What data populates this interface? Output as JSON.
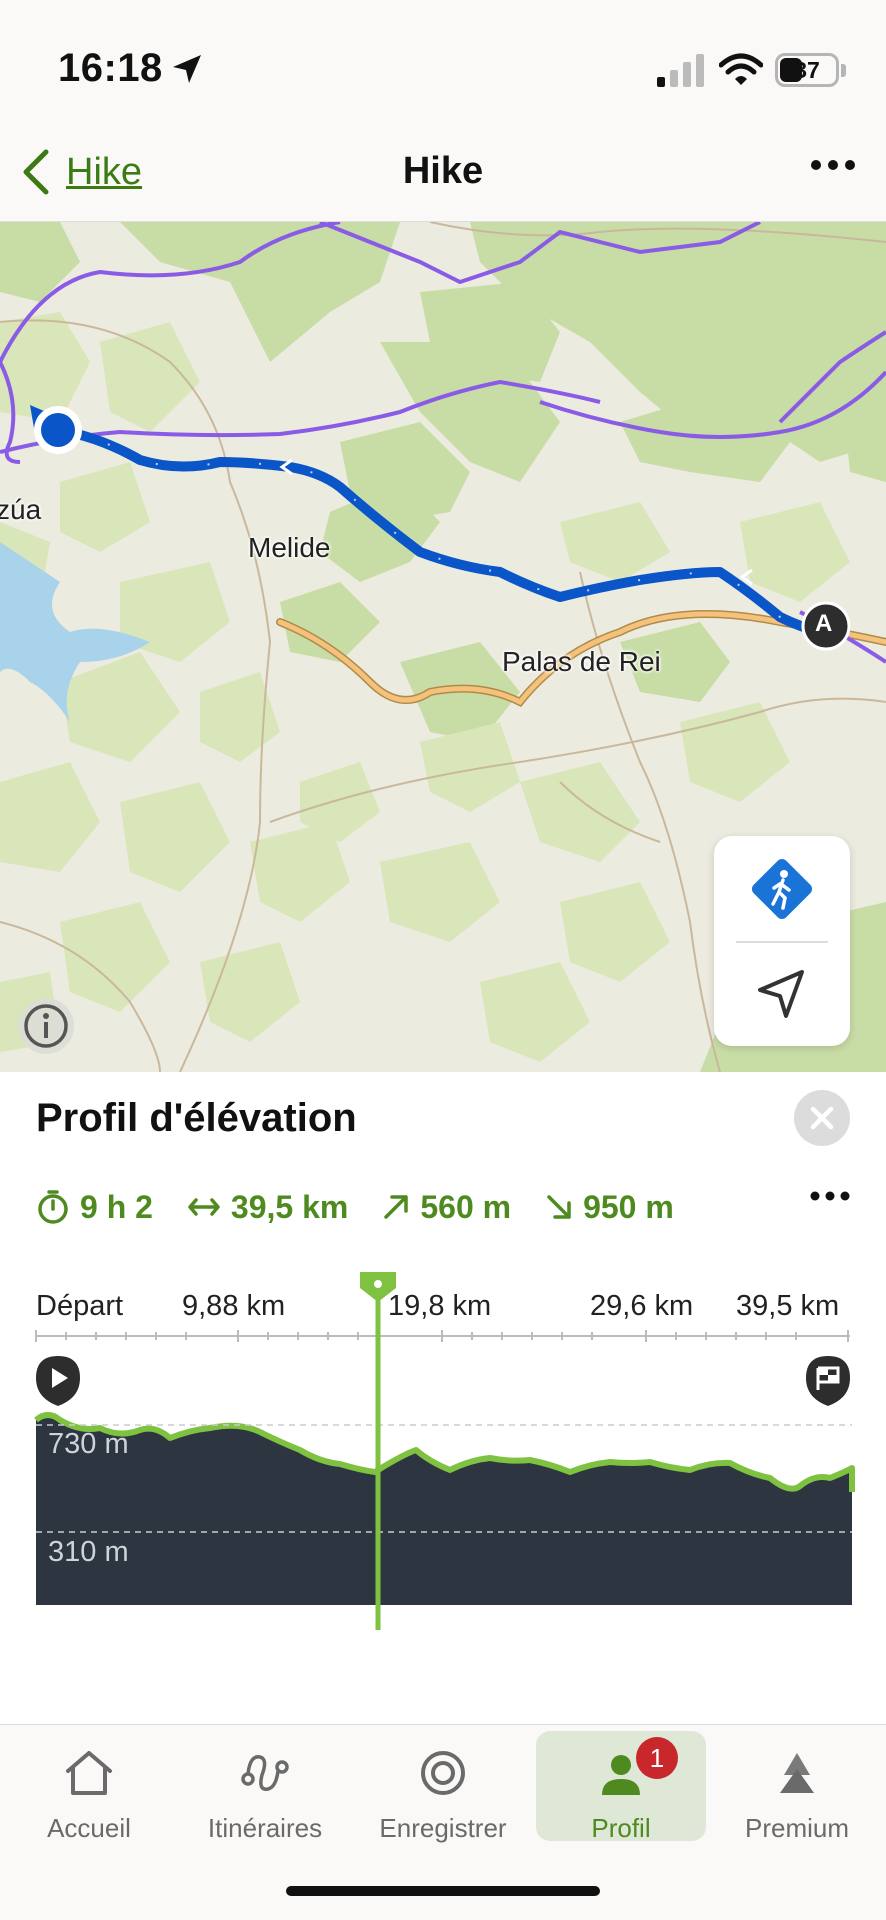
{
  "status": {
    "time": "16:18",
    "battery": "37"
  },
  "nav": {
    "back_label": "Hike",
    "title": "Hike"
  },
  "map": {
    "place_labels": [
      "Melide",
      "Palas de Rei",
      "zúa"
    ],
    "start_marker": "A"
  },
  "elevation": {
    "title": "Profil d'élévation",
    "stats": {
      "duration": "9 h 2",
      "distance": "39,5 km",
      "ascent": "560 m",
      "descent": "950 m"
    },
    "axis": [
      "Départ",
      "9,88 km",
      "19,8 km",
      "29,6 km",
      "39,5 km"
    ],
    "y_labels": [
      "730 m",
      "310 m"
    ]
  },
  "tabs": [
    {
      "label": "Accueil"
    },
    {
      "label": "Itinéraires"
    },
    {
      "label": "Enregistrer"
    },
    {
      "label": "Profil",
      "badge": "1"
    },
    {
      "label": "Premium"
    }
  ],
  "colors": {
    "accent": "#4e8a1f",
    "route": "#0a55c8",
    "chart_fill": "#2c3540"
  }
}
